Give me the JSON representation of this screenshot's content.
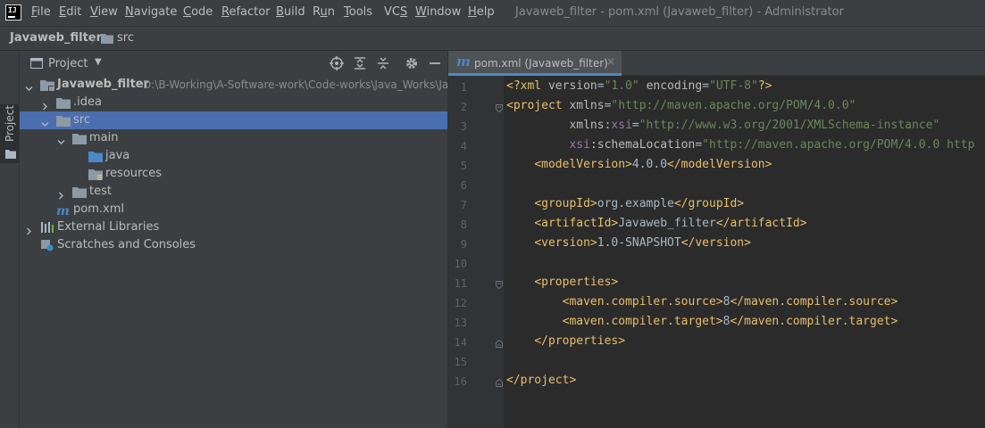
{
  "menubar": {
    "app_icon_text": "IJ",
    "items": [
      "File",
      "Edit",
      "View",
      "Navigate",
      "Code",
      "Refactor",
      "Build",
      "Run",
      "Tools",
      "VCS",
      "Window",
      "Help"
    ],
    "mnemonics": [
      "F",
      "E",
      "V",
      "N",
      "C",
      "R",
      "B",
      "u",
      "T",
      "S",
      "W",
      "H"
    ],
    "window_title": "Javaweb_filter - pom.xml (Javaweb_filter) - Administrator"
  },
  "breadcrumb": {
    "project": "Javaweb_filter",
    "folder": "src"
  },
  "toolstrip": {
    "project_label": "Project"
  },
  "project_panel": {
    "title": "Project",
    "header_icons": [
      "locate-icon",
      "expand-all-icon",
      "collapse-all-icon",
      "settings-icon",
      "hide-icon"
    ],
    "tree": [
      {
        "label": "Javaweb_filter",
        "path": "D:\\B-Working\\A-Software-work\\Code-works\\Java_Works\\Ja",
        "icon": "module-folder",
        "depth": 0,
        "expanded": true,
        "bold": true
      },
      {
        "label": ".idea",
        "icon": "folder",
        "depth": 1,
        "expanded": false
      },
      {
        "label": "src",
        "icon": "folder",
        "depth": 1,
        "expanded": true,
        "selected": true
      },
      {
        "label": "main",
        "icon": "folder",
        "depth": 2,
        "expanded": true
      },
      {
        "label": "java",
        "icon": "source-folder",
        "depth": 3
      },
      {
        "label": "resources",
        "icon": "resource-folder",
        "depth": 3
      },
      {
        "label": "test",
        "icon": "folder",
        "depth": 2,
        "expanded": false
      },
      {
        "label": "pom.xml",
        "icon": "maven",
        "depth": 1
      },
      {
        "label": "External Libraries",
        "icon": "libraries",
        "depth": 0,
        "expanded": false
      },
      {
        "label": "Scratches and Consoles",
        "icon": "scratches",
        "depth": 0
      }
    ]
  },
  "editor": {
    "tab": {
      "icon_text": "m",
      "label": "pom.xml (Javaweb_filter)",
      "close": "×"
    },
    "line_numbers": [
      "1",
      "2",
      "3",
      "4",
      "5",
      "6",
      "7",
      "8",
      "9",
      "10",
      "11",
      "12",
      "13",
      "14",
      "15",
      "16"
    ],
    "lines": [
      [
        [
          "tag",
          "<?xml "
        ],
        [
          "attr",
          "version"
        ],
        [
          "txt",
          "="
        ],
        [
          "str",
          "\"1.0\""
        ],
        [
          "txt",
          " "
        ],
        [
          "attr",
          "encoding"
        ],
        [
          "txt",
          "="
        ],
        [
          "str",
          "\"UTF-8\""
        ],
        [
          "tag",
          "?>"
        ]
      ],
      [
        [
          "tag",
          "<project "
        ],
        [
          "attr",
          "xmlns"
        ],
        [
          "txt",
          "="
        ],
        [
          "str",
          "\"http://maven.apache.org/POM/4.0.0\""
        ]
      ],
      [
        [
          "txt",
          "         "
        ],
        [
          "attr",
          "xmlns:"
        ],
        [
          "ns",
          "xsi"
        ],
        [
          "txt",
          "="
        ],
        [
          "str",
          "\"http://www.w3.org/2001/XMLSchema-instance\""
        ]
      ],
      [
        [
          "txt",
          "         "
        ],
        [
          "ns",
          "xsi"
        ],
        [
          "attr",
          ":schemaLocation"
        ],
        [
          "txt",
          "="
        ],
        [
          "str",
          "\"http://maven.apache.org/POM/4.0.0 http"
        ]
      ],
      [
        [
          "txt",
          "    "
        ],
        [
          "tag",
          "<modelVersion>"
        ],
        [
          "txt",
          "4.0.0"
        ],
        [
          "tag",
          "</modelVersion>"
        ]
      ],
      [],
      [
        [
          "txt",
          "    "
        ],
        [
          "tag",
          "<groupId>"
        ],
        [
          "txt",
          "org.example"
        ],
        [
          "tag",
          "</groupId>"
        ]
      ],
      [
        [
          "txt",
          "    "
        ],
        [
          "tag",
          "<artifactId>"
        ],
        [
          "txt",
          "Javaweb_filter"
        ],
        [
          "tag",
          "</artifactId>"
        ]
      ],
      [
        [
          "txt",
          "    "
        ],
        [
          "tag",
          "<version>"
        ],
        [
          "txt",
          "1.0-SNAPSHOT"
        ],
        [
          "tag",
          "</version>"
        ]
      ],
      [],
      [
        [
          "txt",
          "    "
        ],
        [
          "tag",
          "<properties>"
        ]
      ],
      [
        [
          "txt",
          "        "
        ],
        [
          "tag",
          "<maven.compiler.source>"
        ],
        [
          "txt",
          "8"
        ],
        [
          "tag",
          "</maven.compiler.source>"
        ]
      ],
      [
        [
          "txt",
          "        "
        ],
        [
          "tag",
          "<maven.compiler.target>"
        ],
        [
          "txt",
          "8"
        ],
        [
          "tag",
          "</maven.compiler.target>"
        ]
      ],
      [
        [
          "txt",
          "    "
        ],
        [
          "tag",
          "</properties>"
        ]
      ],
      [],
      [
        [
          "tag",
          "</project>"
        ]
      ]
    ]
  }
}
